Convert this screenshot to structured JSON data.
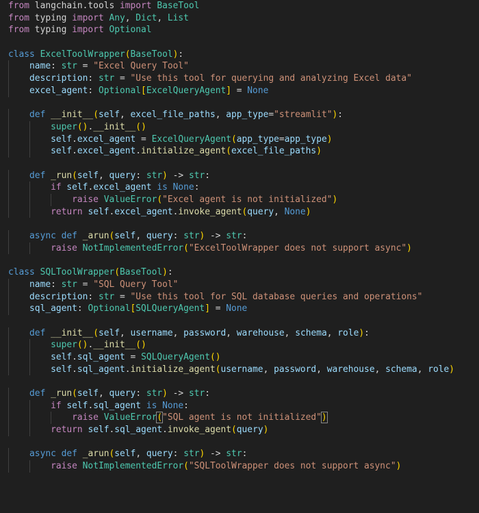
{
  "editor": {
    "language": "python",
    "lines": [
      [
        [
          "kw",
          "from"
        ],
        [
          "plain",
          " langchain.tools "
        ],
        [
          "kw",
          "import"
        ],
        [
          "cls",
          " BaseTool"
        ]
      ],
      [
        [
          "kw",
          "from"
        ],
        [
          "plain",
          " typing "
        ],
        [
          "kw",
          "import"
        ],
        [
          "cls",
          " Any"
        ],
        [
          "plain",
          ", "
        ],
        [
          "cls",
          "Dict"
        ],
        [
          "plain",
          ", "
        ],
        [
          "cls",
          "List"
        ]
      ],
      [
        [
          "kw",
          "from"
        ],
        [
          "plain",
          " typing "
        ],
        [
          "kw",
          "import"
        ],
        [
          "cls",
          " Optional"
        ]
      ],
      [],
      [
        [
          "dec",
          "class"
        ],
        [
          "plain",
          " "
        ],
        [
          "cls",
          "ExcelToolWrapper"
        ],
        [
          "b1",
          "("
        ],
        [
          "cls",
          "BaseTool"
        ],
        [
          "b1",
          ")"
        ],
        [
          "plain",
          ":"
        ]
      ],
      [
        [
          "plain",
          "    "
        ],
        [
          "var",
          "name"
        ],
        [
          "plain",
          ": "
        ],
        [
          "cls",
          "str"
        ],
        [
          "plain",
          " = "
        ],
        [
          "str",
          "\"Excel Query Tool\""
        ]
      ],
      [
        [
          "plain",
          "    "
        ],
        [
          "var",
          "description"
        ],
        [
          "plain",
          ": "
        ],
        [
          "cls",
          "str"
        ],
        [
          "plain",
          " = "
        ],
        [
          "str",
          "\"Use this tool for querying and analyzing Excel data\""
        ]
      ],
      [
        [
          "plain",
          "    "
        ],
        [
          "var",
          "excel_agent"
        ],
        [
          "plain",
          ": "
        ],
        [
          "cls",
          "Optional"
        ],
        [
          "b1",
          "["
        ],
        [
          "cls",
          "ExcelQueryAgent"
        ],
        [
          "b1",
          "]"
        ],
        [
          "plain",
          " = "
        ],
        [
          "const",
          "None"
        ]
      ],
      [],
      [
        [
          "plain",
          "    "
        ],
        [
          "dec",
          "def"
        ],
        [
          "plain",
          " "
        ],
        [
          "fn",
          "__init__"
        ],
        [
          "b1",
          "("
        ],
        [
          "var",
          "self"
        ],
        [
          "plain",
          ", "
        ],
        [
          "var",
          "excel_file_paths"
        ],
        [
          "plain",
          ", "
        ],
        [
          "var",
          "app_type"
        ],
        [
          "plain",
          "="
        ],
        [
          "str",
          "\"streamlit\""
        ],
        [
          "b1",
          ")"
        ],
        [
          "plain",
          ":"
        ]
      ],
      [
        [
          "plain",
          "        "
        ],
        [
          "cls",
          "super"
        ],
        [
          "b1",
          "("
        ],
        [
          "b1",
          ")"
        ],
        [
          "plain",
          "."
        ],
        [
          "fn",
          "__init__"
        ],
        [
          "b1",
          "("
        ],
        [
          "b1",
          ")"
        ]
      ],
      [
        [
          "plain",
          "        "
        ],
        [
          "var",
          "self"
        ],
        [
          "plain",
          "."
        ],
        [
          "var",
          "excel_agent"
        ],
        [
          "plain",
          " = "
        ],
        [
          "cls",
          "ExcelQueryAgent"
        ],
        [
          "b1",
          "("
        ],
        [
          "var",
          "app_type"
        ],
        [
          "plain",
          "="
        ],
        [
          "var",
          "app_type"
        ],
        [
          "b1",
          ")"
        ]
      ],
      [
        [
          "plain",
          "        "
        ],
        [
          "var",
          "self"
        ],
        [
          "plain",
          "."
        ],
        [
          "var",
          "excel_agent"
        ],
        [
          "plain",
          "."
        ],
        [
          "fn",
          "initialize_agent"
        ],
        [
          "b1",
          "("
        ],
        [
          "var",
          "excel_file_paths"
        ],
        [
          "b1",
          ")"
        ]
      ],
      [],
      [
        [
          "plain",
          "    "
        ],
        [
          "dec",
          "def"
        ],
        [
          "plain",
          " "
        ],
        [
          "fn",
          "_run"
        ],
        [
          "b1",
          "("
        ],
        [
          "var",
          "self"
        ],
        [
          "plain",
          ", "
        ],
        [
          "var",
          "query"
        ],
        [
          "plain",
          ": "
        ],
        [
          "cls",
          "str"
        ],
        [
          "b1",
          ")"
        ],
        [
          "plain",
          " -> "
        ],
        [
          "cls",
          "str"
        ],
        [
          "plain",
          ":"
        ]
      ],
      [
        [
          "plain",
          "        "
        ],
        [
          "kw",
          "if"
        ],
        [
          "plain",
          " "
        ],
        [
          "var",
          "self"
        ],
        [
          "plain",
          "."
        ],
        [
          "var",
          "excel_agent"
        ],
        [
          "plain",
          " "
        ],
        [
          "dec",
          "is"
        ],
        [
          "plain",
          " "
        ],
        [
          "const",
          "None"
        ],
        [
          "plain",
          ":"
        ]
      ],
      [
        [
          "plain",
          "            "
        ],
        [
          "kw",
          "raise"
        ],
        [
          "plain",
          " "
        ],
        [
          "cls",
          "ValueError"
        ],
        [
          "b1",
          "("
        ],
        [
          "str",
          "\"Excel agent is not initialized\""
        ],
        [
          "b1",
          ")"
        ]
      ],
      [
        [
          "plain",
          "        "
        ],
        [
          "kw",
          "return"
        ],
        [
          "plain",
          " "
        ],
        [
          "var",
          "self"
        ],
        [
          "plain",
          "."
        ],
        [
          "var",
          "excel_agent"
        ],
        [
          "plain",
          "."
        ],
        [
          "fn",
          "invoke_agent"
        ],
        [
          "b1",
          "("
        ],
        [
          "var",
          "query"
        ],
        [
          "plain",
          ", "
        ],
        [
          "const",
          "None"
        ],
        [
          "b1",
          ")"
        ]
      ],
      [],
      [
        [
          "plain",
          "    "
        ],
        [
          "dec",
          "async"
        ],
        [
          "plain",
          " "
        ],
        [
          "dec",
          "def"
        ],
        [
          "plain",
          " "
        ],
        [
          "fn",
          "_arun"
        ],
        [
          "b1",
          "("
        ],
        [
          "var",
          "self"
        ],
        [
          "plain",
          ", "
        ],
        [
          "var",
          "query"
        ],
        [
          "plain",
          ": "
        ],
        [
          "cls",
          "str"
        ],
        [
          "b1",
          ")"
        ],
        [
          "plain",
          " -> "
        ],
        [
          "cls",
          "str"
        ],
        [
          "plain",
          ":"
        ]
      ],
      [
        [
          "plain",
          "        "
        ],
        [
          "kw",
          "raise"
        ],
        [
          "plain",
          " "
        ],
        [
          "cls",
          "NotImplementedError"
        ],
        [
          "b1",
          "("
        ],
        [
          "str",
          "\"ExcelToolWrapper does not support async\""
        ],
        [
          "b1",
          ")"
        ]
      ],
      [],
      [
        [
          "dec",
          "class"
        ],
        [
          "plain",
          " "
        ],
        [
          "cls",
          "SQLToolWrapper"
        ],
        [
          "b1",
          "("
        ],
        [
          "cls",
          "BaseTool"
        ],
        [
          "b1",
          ")"
        ],
        [
          "plain",
          ":"
        ]
      ],
      [
        [
          "plain",
          "    "
        ],
        [
          "var",
          "name"
        ],
        [
          "plain",
          ": "
        ],
        [
          "cls",
          "str"
        ],
        [
          "plain",
          " = "
        ],
        [
          "str",
          "\"SQL Query Tool\""
        ]
      ],
      [
        [
          "plain",
          "    "
        ],
        [
          "var",
          "description"
        ],
        [
          "plain",
          ": "
        ],
        [
          "cls",
          "str"
        ],
        [
          "plain",
          " = "
        ],
        [
          "str",
          "\"Use this tool for SQL database queries and operations\""
        ]
      ],
      [
        [
          "plain",
          "    "
        ],
        [
          "var",
          "sql_agent"
        ],
        [
          "plain",
          ": "
        ],
        [
          "cls",
          "Optional"
        ],
        [
          "b1",
          "["
        ],
        [
          "cls",
          "SQLQueryAgent"
        ],
        [
          "b1",
          "]"
        ],
        [
          "plain",
          " = "
        ],
        [
          "const",
          "None"
        ]
      ],
      [],
      [
        [
          "plain",
          "    "
        ],
        [
          "dec",
          "def"
        ],
        [
          "plain",
          " "
        ],
        [
          "fn",
          "__init__"
        ],
        [
          "b1",
          "("
        ],
        [
          "var",
          "self"
        ],
        [
          "plain",
          ", "
        ],
        [
          "var",
          "username"
        ],
        [
          "plain",
          ", "
        ],
        [
          "var",
          "password"
        ],
        [
          "plain",
          ", "
        ],
        [
          "var",
          "warehouse"
        ],
        [
          "plain",
          ", "
        ],
        [
          "var",
          "schema"
        ],
        [
          "plain",
          ", "
        ],
        [
          "var",
          "role"
        ],
        [
          "b1",
          ")"
        ],
        [
          "plain",
          ":"
        ]
      ],
      [
        [
          "plain",
          "        "
        ],
        [
          "cls",
          "super"
        ],
        [
          "b1",
          "("
        ],
        [
          "b1",
          ")"
        ],
        [
          "plain",
          "."
        ],
        [
          "fn",
          "__init__"
        ],
        [
          "b1",
          "("
        ],
        [
          "b1",
          ")"
        ]
      ],
      [
        [
          "plain",
          "        "
        ],
        [
          "var",
          "self"
        ],
        [
          "plain",
          "."
        ],
        [
          "var",
          "sql_agent"
        ],
        [
          "plain",
          " = "
        ],
        [
          "cls",
          "SQLQueryAgent"
        ],
        [
          "b1",
          "("
        ],
        [
          "b1",
          ")"
        ]
      ],
      [
        [
          "plain",
          "        "
        ],
        [
          "var",
          "self"
        ],
        [
          "plain",
          "."
        ],
        [
          "var",
          "sql_agent"
        ],
        [
          "plain",
          "."
        ],
        [
          "fn",
          "initialize_agent"
        ],
        [
          "b1",
          "("
        ],
        [
          "var",
          "username"
        ],
        [
          "plain",
          ", "
        ],
        [
          "var",
          "password"
        ],
        [
          "plain",
          ", "
        ],
        [
          "var",
          "warehouse"
        ],
        [
          "plain",
          ", "
        ],
        [
          "var",
          "schema"
        ],
        [
          "plain",
          ", "
        ],
        [
          "var",
          "role"
        ],
        [
          "b1",
          ")"
        ]
      ],
      [],
      [
        [
          "plain",
          "    "
        ],
        [
          "dec",
          "def"
        ],
        [
          "plain",
          " "
        ],
        [
          "fn",
          "_run"
        ],
        [
          "b1",
          "("
        ],
        [
          "var",
          "self"
        ],
        [
          "plain",
          ", "
        ],
        [
          "var",
          "query"
        ],
        [
          "plain",
          ": "
        ],
        [
          "cls",
          "str"
        ],
        [
          "b1",
          ")"
        ],
        [
          "plain",
          " -> "
        ],
        [
          "cls",
          "str"
        ],
        [
          "plain",
          ":"
        ]
      ],
      [
        [
          "plain",
          "        "
        ],
        [
          "kw",
          "if"
        ],
        [
          "plain",
          " "
        ],
        [
          "var",
          "self"
        ],
        [
          "plain",
          "."
        ],
        [
          "var",
          "sql_agent"
        ],
        [
          "plain",
          " "
        ],
        [
          "dec",
          "is"
        ],
        [
          "plain",
          " "
        ],
        [
          "const",
          "None"
        ],
        [
          "plain",
          ":"
        ]
      ],
      [
        [
          "plain",
          "            "
        ],
        [
          "kw",
          "raise"
        ],
        [
          "plain",
          " "
        ],
        [
          "cls",
          "ValueError"
        ],
        [
          "b1hl",
          "("
        ],
        [
          "str",
          "\"SQL agent is not initialized\""
        ],
        [
          "b1hl",
          ")"
        ]
      ],
      [
        [
          "plain",
          "        "
        ],
        [
          "kw",
          "return"
        ],
        [
          "plain",
          " "
        ],
        [
          "var",
          "self"
        ],
        [
          "plain",
          "."
        ],
        [
          "var",
          "sql_agent"
        ],
        [
          "plain",
          "."
        ],
        [
          "fn",
          "invoke_agent"
        ],
        [
          "b1",
          "("
        ],
        [
          "var",
          "query"
        ],
        [
          "b1",
          ")"
        ]
      ],
      [],
      [
        [
          "plain",
          "    "
        ],
        [
          "dec",
          "async"
        ],
        [
          "plain",
          " "
        ],
        [
          "dec",
          "def"
        ],
        [
          "plain",
          " "
        ],
        [
          "fn",
          "_arun"
        ],
        [
          "b1",
          "("
        ],
        [
          "var",
          "self"
        ],
        [
          "plain",
          ", "
        ],
        [
          "var",
          "query"
        ],
        [
          "plain",
          ": "
        ],
        [
          "cls",
          "str"
        ],
        [
          "b1",
          ")"
        ],
        [
          "plain",
          " -> "
        ],
        [
          "cls",
          "str"
        ],
        [
          "plain",
          ":"
        ]
      ],
      [
        [
          "plain",
          "        "
        ],
        [
          "kw",
          "raise"
        ],
        [
          "plain",
          " "
        ],
        [
          "cls",
          "NotImplementedError"
        ],
        [
          "b1",
          "("
        ],
        [
          "str",
          "\"SQLToolWrapper does not support async\""
        ],
        [
          "b1",
          ")"
        ]
      ]
    ]
  }
}
